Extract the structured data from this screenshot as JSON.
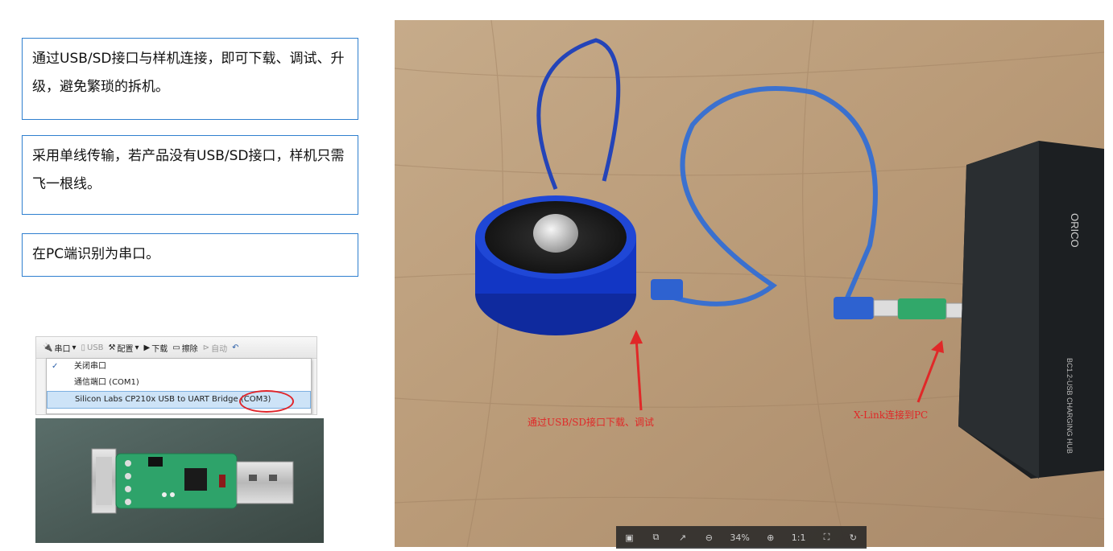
{
  "notes": [
    "通过USB/SD接口与样机连接，即可下载、调试、升级，避免繁琐的拆机。",
    "采用单线传输，若产品没有USB/SD接口，样机只需飞一根线。",
    "在PC端识别为串口。"
  ],
  "toolbar": {
    "serial": "串口",
    "usb": "USB",
    "config": "配置",
    "download": "下载",
    "erase": "擦除",
    "auto": "自动"
  },
  "menu": {
    "items": [
      {
        "label": "关闭串口",
        "checked": true
      },
      {
        "label": "通信端口 (COM1)",
        "checked": false
      },
      {
        "label": "Silicon Labs CP210x USB to UART Bridge (COM3)",
        "checked": false,
        "selected": true
      }
    ]
  },
  "photo": {
    "annotation_left": "通过USB/SD接口下载、调试",
    "annotation_right": "X-Link连接到PC",
    "hub_brand": "ORICO",
    "hub_label": "BC1.2-USB CHARGING HUB"
  },
  "viewer": {
    "zoom": "34%",
    "actual_size": "1:1",
    "icons": [
      "save-icon",
      "resize-icon",
      "share-icon",
      "zoom-out-icon",
      "zoom-in-icon",
      "actual-size-icon",
      "fit-icon",
      "rotate-icon"
    ]
  }
}
